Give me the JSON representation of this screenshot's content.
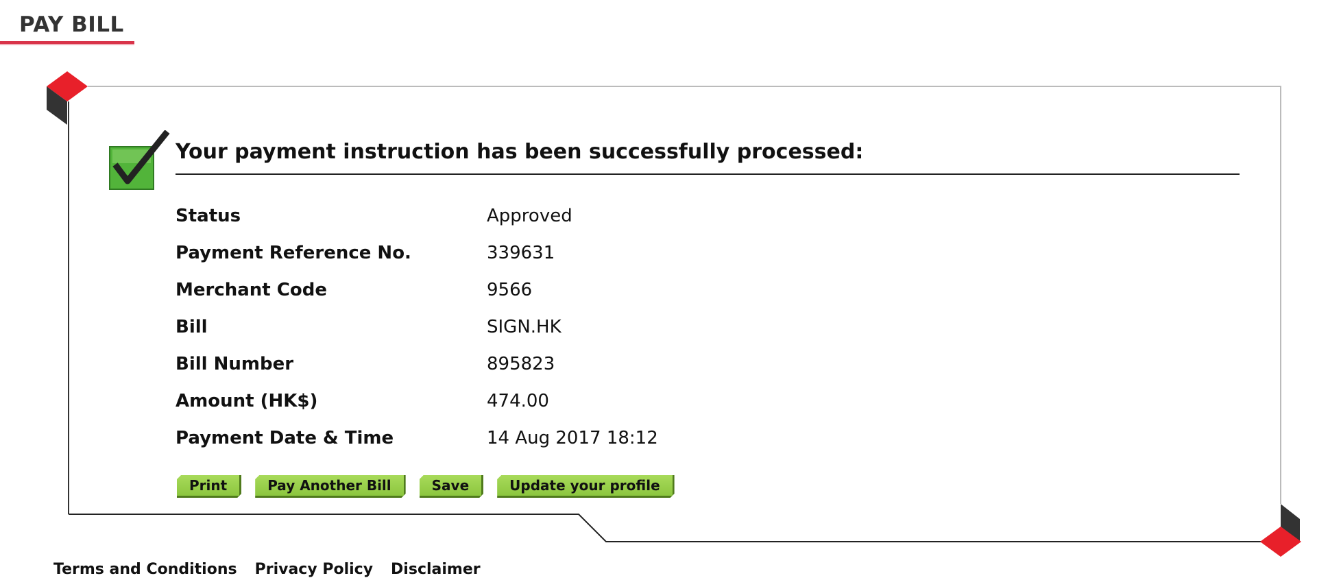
{
  "page": {
    "heading": "PAY BILL"
  },
  "confirmation": {
    "title": "Your payment instruction has been successfully processed:",
    "details": [
      {
        "label": "Status",
        "value": "Approved"
      },
      {
        "label": "Payment Reference No.",
        "value": "339631"
      },
      {
        "label": "Merchant Code",
        "value": "9566"
      },
      {
        "label": "Bill",
        "value": "SIGN.HK"
      },
      {
        "label": "Bill Number",
        "value": "895823"
      },
      {
        "label": "Amount (HK$)",
        "value": "474.00"
      },
      {
        "label": "Payment Date & Time",
        "value": "14 Aug 2017 18:12"
      }
    ]
  },
  "actions": {
    "print_label": "Print",
    "pay_another_label": "Pay Another Bill",
    "save_label": "Save",
    "update_profile_label": "Update your profile"
  },
  "footer": {
    "links": [
      "Terms and Conditions",
      "Privacy Policy",
      "Disclaimer"
    ]
  },
  "colors": {
    "accent_red": "#e8202a",
    "button_green": "#8cc63f",
    "check_green": "#3a9b2a",
    "frame_dark": "#333333"
  },
  "icons": {
    "success": "checkmark-icon"
  }
}
